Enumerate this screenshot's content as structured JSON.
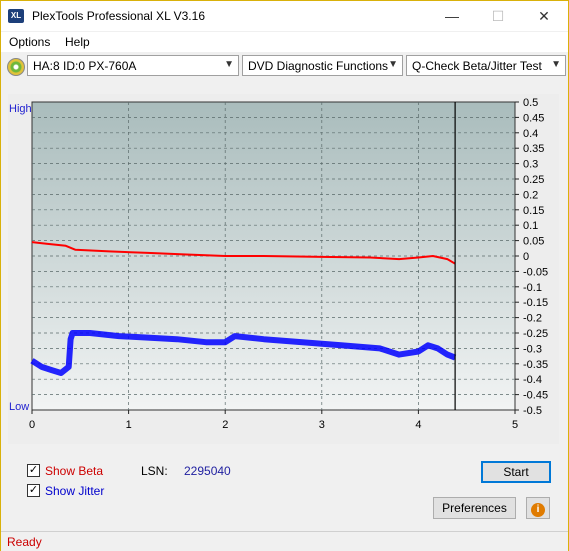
{
  "window": {
    "title": "PlexTools Professional XL V3.16",
    "icon_text": "XL"
  },
  "titlebar_buttons": {
    "minimize": "—",
    "maximize": "☐",
    "close": "✕"
  },
  "menu": [
    {
      "label": "Options"
    },
    {
      "label": "Help"
    }
  ],
  "toolbar": {
    "drive": "HA:8 ID:0  PX-760A",
    "function": "DVD Diagnostic Functions",
    "test": "Q-Check Beta/Jitter Test"
  },
  "chart_data": {
    "type": "line",
    "left_labels": {
      "top": "High",
      "bottom": "Low"
    },
    "x_ticks": [
      "0",
      "1",
      "2",
      "3",
      "4",
      "5"
    ],
    "xlim": [
      0,
      5
    ],
    "y_ticks": [
      "0.5",
      "0.45",
      "0.4",
      "0.35",
      "0.3",
      "0.25",
      "0.2",
      "0.15",
      "0.1",
      "0.05",
      "0",
      "-0.05",
      "-0.1",
      "-0.15",
      "-0.2",
      "-0.25",
      "-0.3",
      "-0.35",
      "-0.4",
      "-0.45",
      "-0.5"
    ],
    "ylim": [
      -0.5,
      0.5
    ],
    "marker_x": 4.38,
    "grid": true,
    "series": [
      {
        "color": "#ff0000",
        "x": [
          0,
          0.15,
          0.35,
          0.45,
          0.8,
          1.2,
          1.6,
          2.0,
          2.4,
          3.0,
          3.5,
          3.8,
          4.0,
          4.15,
          4.3,
          4.38
        ],
        "y": [
          0.045,
          0.04,
          0.033,
          0.02,
          0.015,
          0.01,
          0.005,
          0.0,
          0.0,
          -0.003,
          -0.005,
          -0.01,
          -0.005,
          0.0,
          -0.01,
          -0.025
        ]
      },
      {
        "color": "#0000ff",
        "x": [
          0,
          0.1,
          0.2,
          0.3,
          0.38,
          0.4,
          0.42,
          0.6,
          0.9,
          1.2,
          1.5,
          1.8,
          2.0,
          2.1,
          2.4,
          2.8,
          3.2,
          3.6,
          3.8,
          4.0,
          4.1,
          4.2,
          4.3,
          4.38
        ],
        "y": [
          -0.34,
          -0.36,
          -0.37,
          -0.38,
          -0.36,
          -0.27,
          -0.25,
          -0.25,
          -0.26,
          -0.265,
          -0.27,
          -0.28,
          -0.28,
          -0.26,
          -0.27,
          -0.28,
          -0.29,
          -0.3,
          -0.32,
          -0.31,
          -0.29,
          -0.3,
          -0.32,
          -0.33
        ]
      }
    ]
  },
  "options": {
    "show_beta": {
      "label": "Show Beta",
      "checked": true,
      "color": "#cc0000"
    },
    "show_jitter": {
      "label": "Show Jitter",
      "checked": true,
      "color": "#0000cc"
    },
    "lsn_label": "LSN:",
    "lsn_value": "2295040"
  },
  "buttons": {
    "start": "Start",
    "preferences": "Preferences",
    "info_icon": "i"
  },
  "status": {
    "text": "Ready",
    "color": "#cc0000"
  }
}
